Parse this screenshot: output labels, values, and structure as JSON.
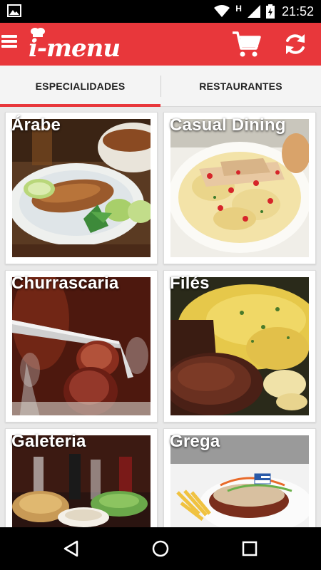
{
  "status_bar": {
    "time": "21:52",
    "network_type": "H",
    "icons": [
      "image-icon",
      "wifi-icon",
      "signal-icon",
      "battery-icon"
    ]
  },
  "app_bar": {
    "logo_text": "i-menu",
    "background_color": "#e8373b",
    "icons": [
      "menu-icon",
      "cart-icon",
      "refresh-icon"
    ]
  },
  "tabs": [
    {
      "label": "ESPECIALIDADES",
      "selected": true
    },
    {
      "label": "RESTAURANTES",
      "selected": false
    }
  ],
  "categories": [
    {
      "label": "Árabe"
    },
    {
      "label": "Casual Dining"
    },
    {
      "label": "Churrascaria"
    },
    {
      "label": "Filés"
    },
    {
      "label": "Galeteria"
    },
    {
      "label": "Grega"
    }
  ],
  "nav_bar": {
    "icons": [
      "back-icon",
      "home-icon",
      "recents-icon"
    ]
  }
}
